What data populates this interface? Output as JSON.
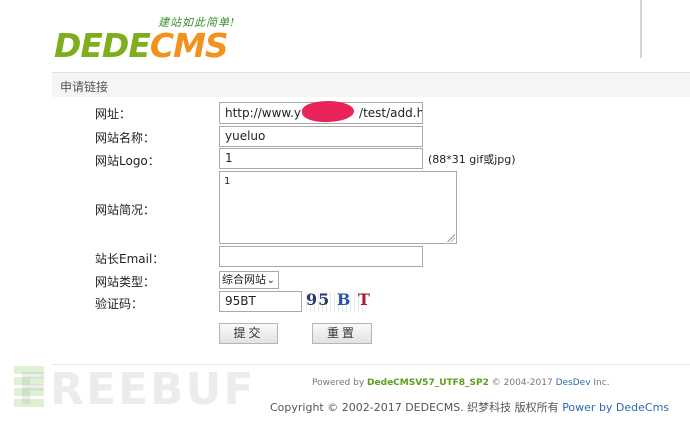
{
  "brand": {
    "slogan": "建站如此简单!",
    "logo_left": "DEDE",
    "logo_right": "CMS"
  },
  "section": {
    "title": "申请链接"
  },
  "form": {
    "url_label": "网址：",
    "url_value": "http://www.y",
    "url_value_tail": "/test/add.htm",
    "name_label": "网站名称：",
    "name_value": "yueluo",
    "logo_label": "网站Logo：",
    "logo_value": "1",
    "logo_hint": "(88*31 gif或jpg)",
    "desc_label": "网站简况：",
    "desc_value": "1",
    "email_label": "站长Email：",
    "email_value": "",
    "type_label": "网站类型：",
    "type_selected": "综合网站",
    "captcha_label": "验证码：",
    "captcha_value": "95BT",
    "captcha_image": [
      "95",
      "B",
      "T"
    ],
    "submit_label": "提交",
    "reset_label": "重置"
  },
  "footer": {
    "powered_prefix": "Powered by",
    "powered_product": "DedeCMSV57_UTF8_SP2",
    "powered_years": "© 2004-2017",
    "powered_vendor": "DesDev",
    "powered_suffix": "Inc.",
    "copyright_text": "Copyright © 2002-2017 DEDECMS. 织梦科技 版权所有",
    "copyright_link": "Power by DedeCms"
  },
  "watermark": "FREEBUF",
  "colors": {
    "logo_green": "#7fae1c",
    "logo_orange": "#f0921c",
    "link_blue": "#2a6ab0",
    "redaction": "#e8245a"
  }
}
